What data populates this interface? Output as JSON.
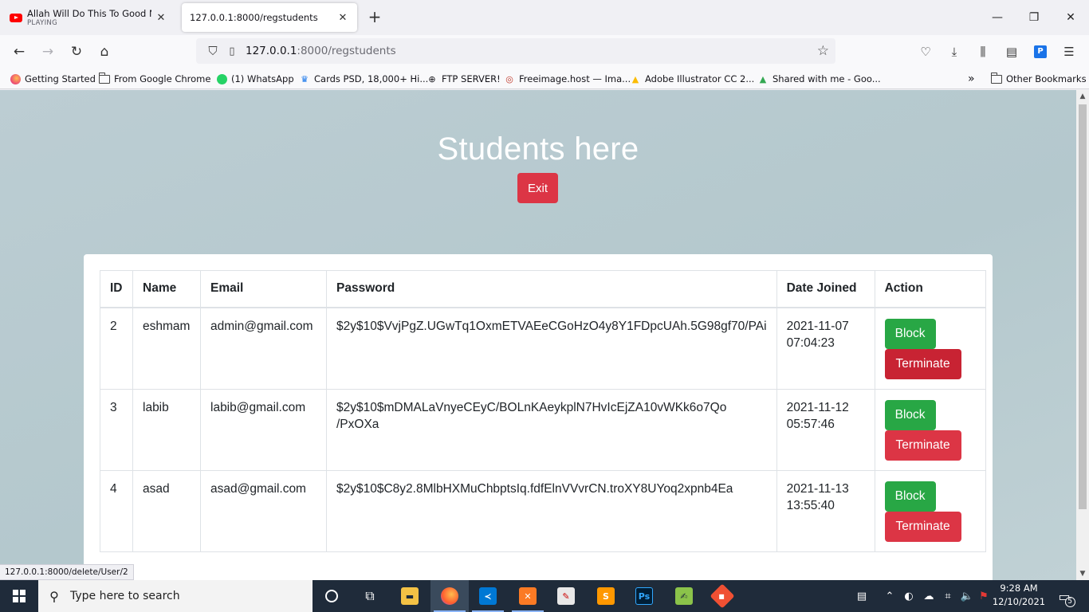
{
  "browser": {
    "tabs": [
      {
        "title": "Allah Will Do This To Good Non",
        "subtitle": "PLAYING",
        "active": false
      },
      {
        "title": "127.0.0.1:8000/regstudents",
        "subtitle": "",
        "active": true
      }
    ],
    "url": {
      "host": "127.0.0.1",
      "path": ":8000/regstudents"
    },
    "bookmarks": [
      "Getting Started",
      "From Google Chrome",
      "(1) WhatsApp",
      "Cards PSD, 18,000+ Hi...",
      "FTP SERVER!",
      "Freeimage.host — Ima...",
      "Adobe Illustrator CC 2...",
      "Shared with me - Goo..."
    ],
    "other_bookmarks": "Other Bookmarks",
    "status_link": "127.0.0.1:8000/delete/User/2"
  },
  "page": {
    "heading": "Students here",
    "exit_label": "Exit",
    "table": {
      "headers": [
        "ID",
        "Name",
        "Email",
        "Password",
        "Date Joined",
        "Action"
      ],
      "rows": [
        {
          "id": "2",
          "name": "eshmam",
          "email": "admin@gmail.com",
          "password": "$2y$10$VvjPgZ.UGwTq1OxmETVAEeCGoHzO4y8Y1FDpcUAh.5G98gf70/PAi",
          "date": "2021-11-07",
          "time": "07:04:23",
          "block": "Block",
          "terminate": "Terminate"
        },
        {
          "id": "3",
          "name": "labib",
          "email": "labib@gmail.com",
          "password": "$2y$10$mDMALaVnyeCEyC/BOLnKAeykplN7HvIcEjZA10vWKk6o7Qo",
          "password_cont": "/PxOXa",
          "date": "2021-11-12",
          "time": "05:57:46",
          "block": "Block",
          "terminate": "Terminate"
        },
        {
          "id": "4",
          "name": "asad",
          "email": "asad@gmail.com",
          "password": "$2y$10$C8y2.8MlbHXMuChbptsIq.fdfElnVVvrCN.troXY8UYoq2xpnb4Ea",
          "date": "2021-11-13",
          "time": "13:55:40",
          "block": "Block",
          "terminate": "Terminate"
        }
      ]
    }
  },
  "taskbar": {
    "search_placeholder": "Type here to search",
    "time": "9:28 AM",
    "date": "12/10/2021",
    "notification_count": "5"
  },
  "colors": {
    "danger": "#dc3545",
    "success": "#28a745",
    "page_bg": "#b4c8cd"
  }
}
